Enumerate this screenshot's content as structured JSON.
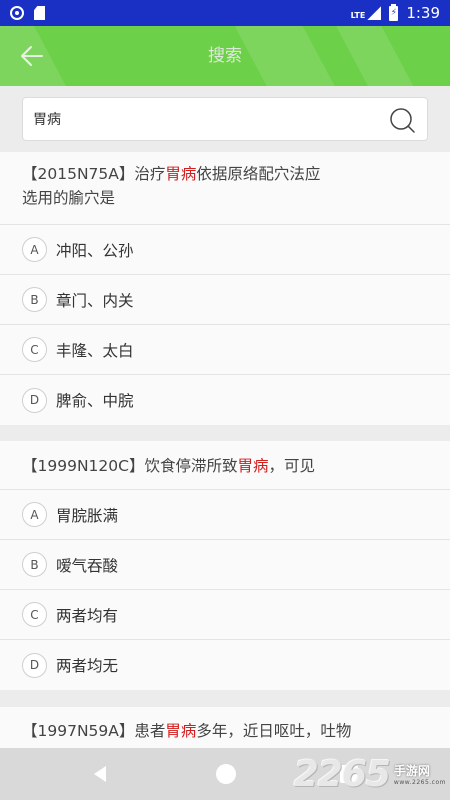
{
  "status_bar": {
    "time": "1:39",
    "network": "LTE",
    "icons": [
      "record-icon",
      "sd-card-icon",
      "lte-icon",
      "signal-icon",
      "battery-charging-icon"
    ]
  },
  "header": {
    "title": "搜索",
    "back_icon": "arrow-left-icon",
    "color": "#6cd048"
  },
  "search": {
    "value": "胃病",
    "icon": "search-icon"
  },
  "highlight_color": "#d21e1e",
  "questions": [
    {
      "prefix": "【2015N75A】治疗",
      "highlight": "胃病",
      "suffix": "依据原络配穴法应",
      "line2": "选用的腧穴是",
      "options": [
        {
          "letter": "A",
          "text": "冲阳、公孙"
        },
        {
          "letter": "B",
          "text": "章门、内关"
        },
        {
          "letter": "C",
          "text": "丰隆、太白"
        },
        {
          "letter": "D",
          "text": "脾俞、中脘"
        }
      ]
    },
    {
      "prefix": "【1999N120C】饮食停滞所致",
      "highlight": "胃病",
      "suffix": "，可见",
      "options": [
        {
          "letter": "A",
          "text": "胃脘胀满"
        },
        {
          "letter": "B",
          "text": "嗳气吞酸"
        },
        {
          "letter": "C",
          "text": "两者均有"
        },
        {
          "letter": "D",
          "text": "两者均无"
        }
      ]
    },
    {
      "prefix": "【1997N59A】患者",
      "highlight": "胃病",
      "suffix": "多年，近日呕吐，吐物"
    }
  ],
  "nav_bar": {
    "icons": [
      "back-triangle-icon",
      "home-circle-icon",
      "recents-square-icon"
    ]
  },
  "watermark": {
    "number": "2265",
    "site": "手游网",
    "url": "www.2265.com"
  }
}
